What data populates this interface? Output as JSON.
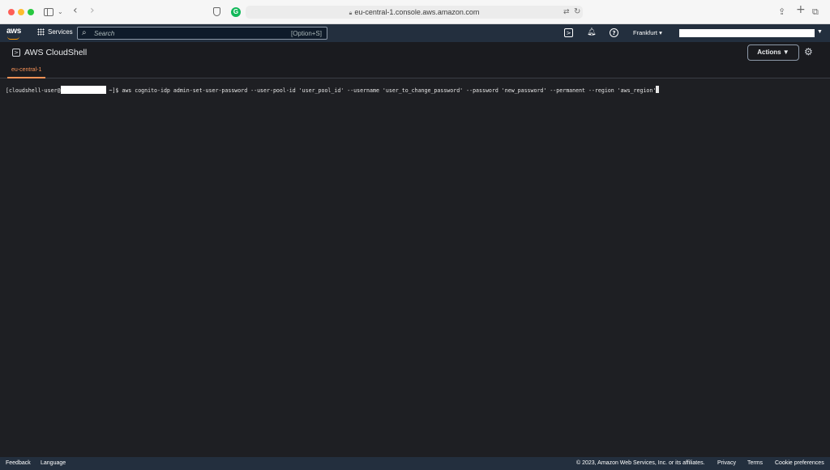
{
  "browser": {
    "url": "eu-central-1.console.aws.amazon.com",
    "extension_badge": "G"
  },
  "aws_nav": {
    "logo": "aws",
    "services_label": "Services",
    "search_placeholder": "Search",
    "search_shortcut": "[Option+S]",
    "region": "Frankfurt ▾"
  },
  "cloudshell": {
    "title": "AWS CloudShell",
    "actions_label": "Actions ▼",
    "tabs": [
      {
        "label": "eu-central-1"
      }
    ]
  },
  "terminal": {
    "prompt_prefix": "[cloudshell-user@",
    "prompt_suffix": " ~]$ ",
    "command": "aws cognito-idp admin-set-user-password --user-pool-id 'user_pool_id' --username 'user_to_change_password' --password 'new_password' --permanent --region 'aws_region'"
  },
  "footer": {
    "feedback": "Feedback",
    "language": "Language",
    "copyright": "© 2023, Amazon Web Services, Inc. or its affiliates.",
    "privacy": "Privacy",
    "terms": "Terms",
    "cookie": "Cookie preferences"
  }
}
